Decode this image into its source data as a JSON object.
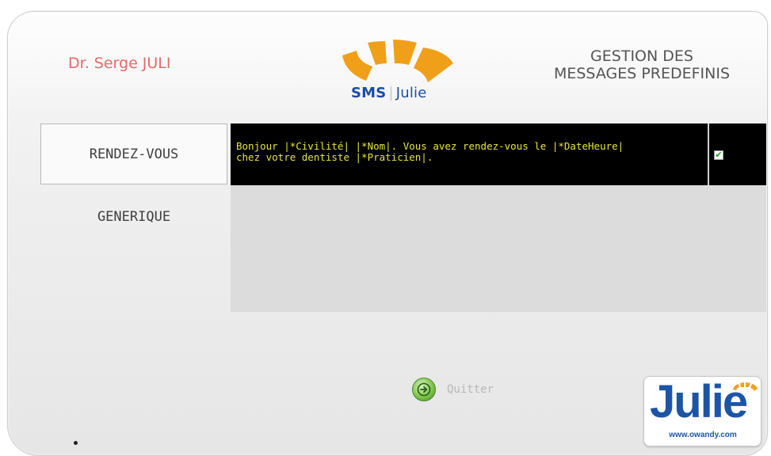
{
  "header": {
    "doctor_name": "Dr. Serge JULI",
    "logo": {
      "sms": "SMS",
      "separator": "|",
      "julie": "Julie"
    },
    "title_line1": "GESTION DES",
    "title_line2": "MESSAGES PREDEFINIS"
  },
  "tabs": [
    {
      "label": "RENDEZ-VOUS",
      "active": true
    },
    {
      "label": "GENERIQUE",
      "active": false
    }
  ],
  "messages": [
    {
      "text": "Bonjour |*Civilité| |*Nom|. Vous avez rendez-vous le |*DateHeure|\nchez votre dentiste |*Praticien|.",
      "checked": true
    }
  ],
  "footer": {
    "quit_label": "Quitter",
    "brand_word": "Julie",
    "brand_url": "www.owandy.com"
  },
  "colors": {
    "doctor_name": "#e36a6a",
    "accent_orange": "#f0a018",
    "brand_blue": "#1b4da6",
    "message_text": "#e8e63c",
    "message_bg": "#000000"
  },
  "icons": {
    "quit": "arrow-right-circle-icon",
    "check": "checkmark-icon"
  }
}
